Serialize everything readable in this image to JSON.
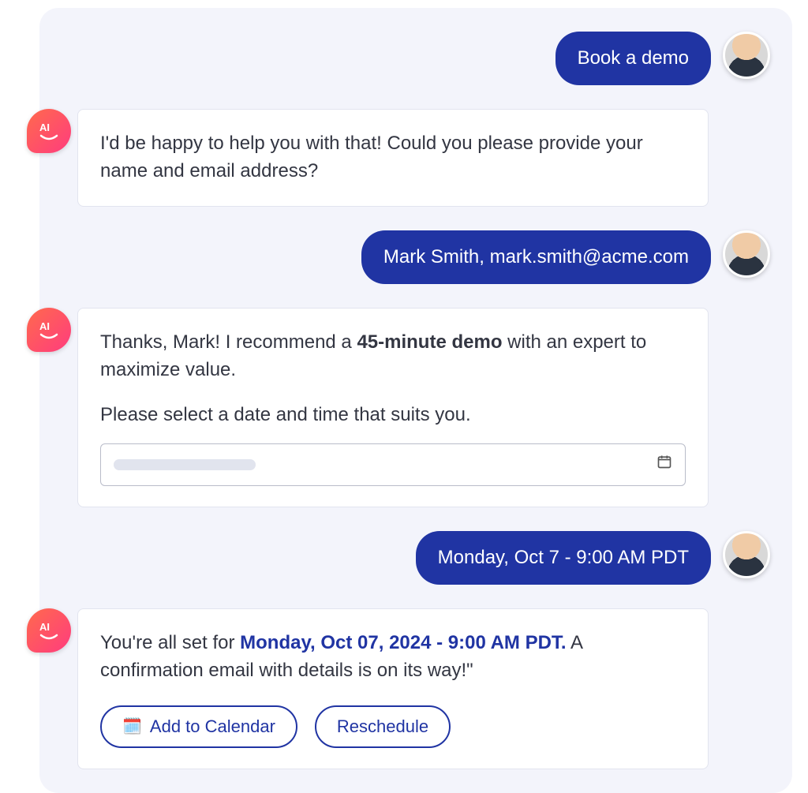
{
  "messages": {
    "u1": "Book a demo",
    "a1": "I'd be happy to help you with that! Could you please provide your name and email address?",
    "u2": "Mark Smith, mark.smith@acme.com",
    "a2_part1": "Thanks, Mark! I recommend a ",
    "a2_strong": "45-minute demo",
    "a2_part2": " with an expert to maximize value.",
    "a2_p2": "Please select a date and time that suits you.",
    "u3": "Monday, Oct 7 - 9:00 AM PDT",
    "a3_part1": "You're all set for ",
    "a3_strong": "Monday, Oct 07, 2024 - 9:00 AM PDT.",
    "a3_part2": " A confirmation email with details is on its way!\""
  },
  "actions": {
    "add_calendar": "Add to Calendar",
    "reschedule": "Reschedule",
    "calendar_emoji": "🗓️"
  },
  "datepicker": {
    "empty": ""
  }
}
